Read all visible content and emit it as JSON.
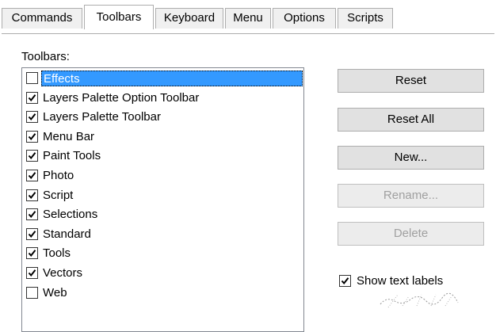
{
  "tabs": [
    {
      "label": "Commands",
      "active": false
    },
    {
      "label": "Toolbars",
      "active": true
    },
    {
      "label": "Keyboard",
      "active": false
    },
    {
      "label": "Menu",
      "active": false
    },
    {
      "label": "Options",
      "active": false
    },
    {
      "label": "Scripts",
      "active": false
    }
  ],
  "panel": {
    "list_label": "Toolbars:",
    "toolbars": [
      {
        "label": "Effects",
        "checked": false,
        "selected": true
      },
      {
        "label": "Layers Palette Option Toolbar",
        "checked": true,
        "selected": false
      },
      {
        "label": "Layers Palette Toolbar",
        "checked": true,
        "selected": false
      },
      {
        "label": "Menu Bar",
        "checked": true,
        "selected": false
      },
      {
        "label": "Paint Tools",
        "checked": true,
        "selected": false
      },
      {
        "label": "Photo",
        "checked": true,
        "selected": false
      },
      {
        "label": "Script",
        "checked": true,
        "selected": false
      },
      {
        "label": "Selections",
        "checked": true,
        "selected": false
      },
      {
        "label": "Standard",
        "checked": true,
        "selected": false
      },
      {
        "label": "Tools",
        "checked": true,
        "selected": false
      },
      {
        "label": "Vectors",
        "checked": true,
        "selected": false
      },
      {
        "label": "Web",
        "checked": false,
        "selected": false
      }
    ],
    "buttons": {
      "reset": "Reset",
      "reset_all": "Reset All",
      "new": "New...",
      "rename": "Rename...",
      "delete": "Delete"
    },
    "show_text_labels": {
      "label": "Show text labels",
      "checked": true
    }
  },
  "colors": {
    "selection": "#3399ff",
    "border": "#adadad",
    "disabled_text": "#a0a0a0"
  }
}
